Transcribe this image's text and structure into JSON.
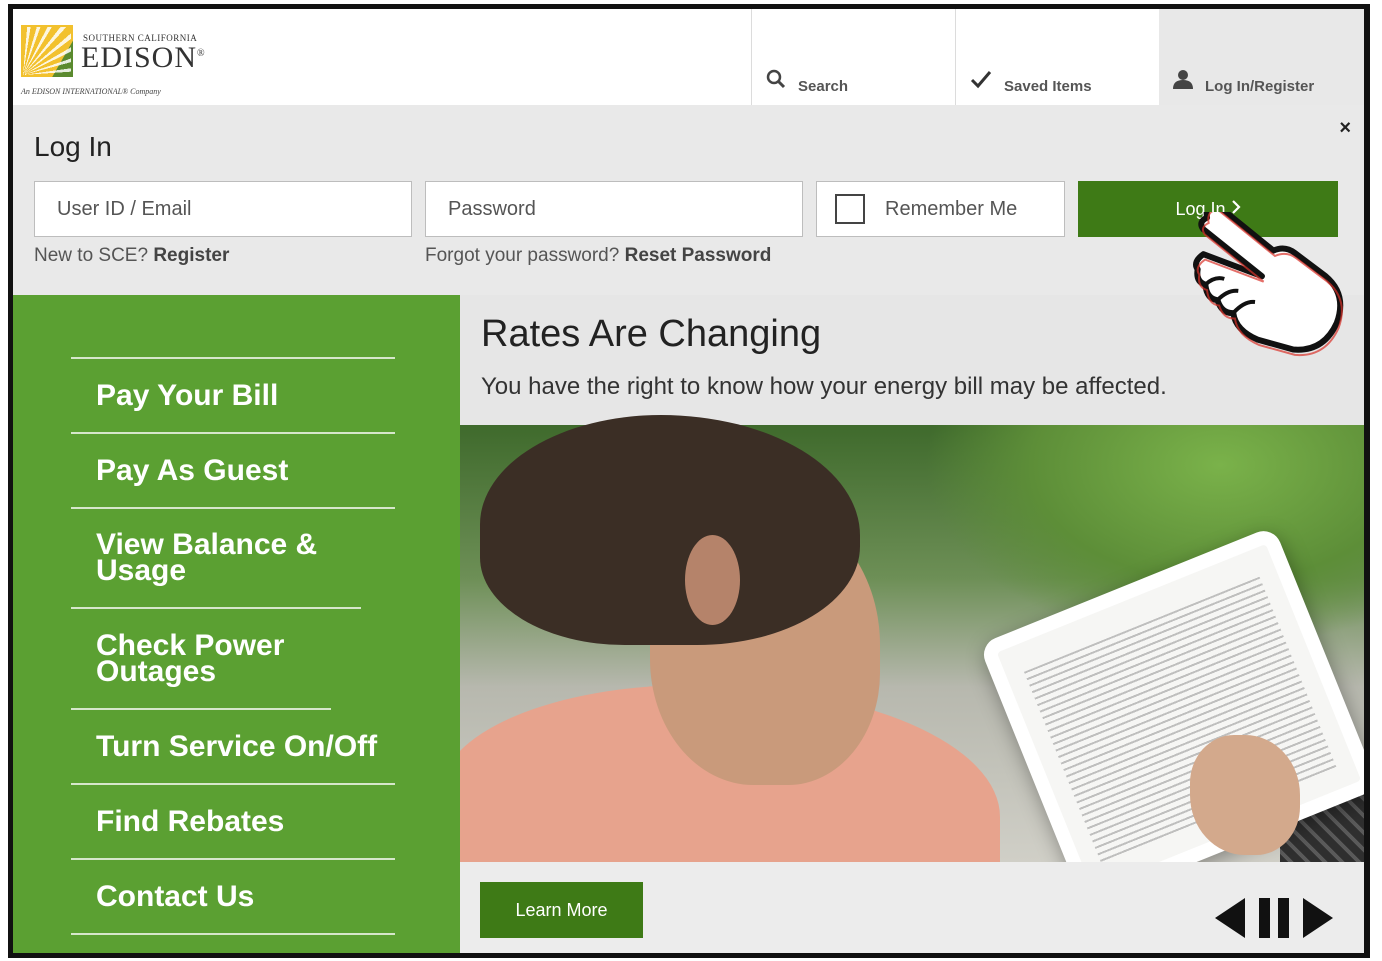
{
  "header": {
    "logo": {
      "top_line": "SOUTHERN CALIFORNIA",
      "name": "EDISON",
      "registered": "®",
      "tagline": "An EDISON INTERNATIONAL® Company"
    },
    "tabs": {
      "search": "Search",
      "saved": "Saved Items",
      "login": "Log In/Register"
    }
  },
  "login": {
    "title": "Log In",
    "close": "×",
    "user_placeholder": "User ID / Email",
    "password_placeholder": "Password",
    "remember": "Remember Me",
    "button": "Log In",
    "new_prefix": "New to SCE? ",
    "register": "Register",
    "forgot_prefix": "Forgot your password? ",
    "reset": "Reset Password"
  },
  "menu": {
    "items": [
      "Pay Your Bill",
      "Pay As Guest",
      "View Balance & Usage",
      "Check Power Outages",
      "Turn Service On/Off",
      "Find Rebates",
      "Contact Us"
    ]
  },
  "hero": {
    "title": "Rates Are Changing",
    "subtitle": "You have the right to know how your energy bill may be affected.",
    "cta": "Learn More"
  },
  "colors": {
    "brand_green": "#5ba032",
    "button_green": "#3e7a16",
    "logo_yellow": "#f2c12e"
  }
}
